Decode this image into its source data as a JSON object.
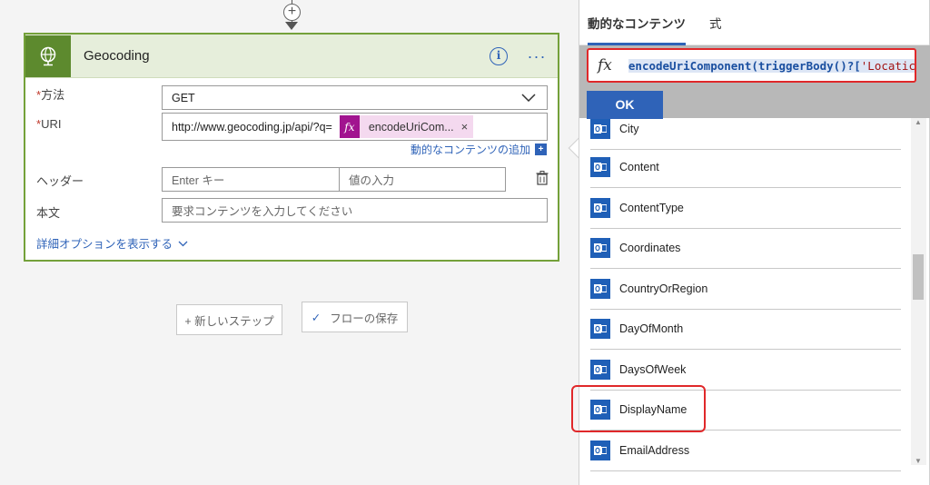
{
  "flow_card": {
    "title": "Geocoding",
    "method_label": "方法",
    "method_value": "GET",
    "uri_label": "URI",
    "uri_value": "http://www.geocoding.jp/api/?q=",
    "uri_token": "encodeUriCom...",
    "add_dynamic_content": "動的なコンテンツの追加",
    "headers_label": "ヘッダー",
    "header_key_placeholder": "Enter キー",
    "header_value_placeholder": "値の入力",
    "body_label": "本文",
    "body_placeholder": "要求コンテンツを入力してください",
    "advanced_link": "詳細オプションを表示する"
  },
  "buttons": {
    "new_step": "+ 新しいステップ",
    "save_flow": "フローの保存"
  },
  "panel": {
    "tabs": [
      "動的なコンテンツ",
      "式"
    ],
    "expression_fn": "encodeUriComponent",
    "expression_mid": "(triggerBody()?[",
    "expression_str": "'Locatic",
    "ok_label": "OK",
    "items": [
      {
        "label": "City"
      },
      {
        "label": "Content"
      },
      {
        "label": "ContentType"
      },
      {
        "label": "Coordinates"
      },
      {
        "label": "CountryOrRegion"
      },
      {
        "label": "DayOfMonth"
      },
      {
        "label": "DaysOfWeek"
      },
      {
        "label": "DisplayName"
      },
      {
        "label": "EmailAddress"
      }
    ]
  },
  "colors": {
    "accent": "#2f63b8",
    "card_border": "#74a13a",
    "card_icon_bg": "#5d8a2e",
    "token": "#a1148f",
    "highlight": "#e0282a"
  }
}
